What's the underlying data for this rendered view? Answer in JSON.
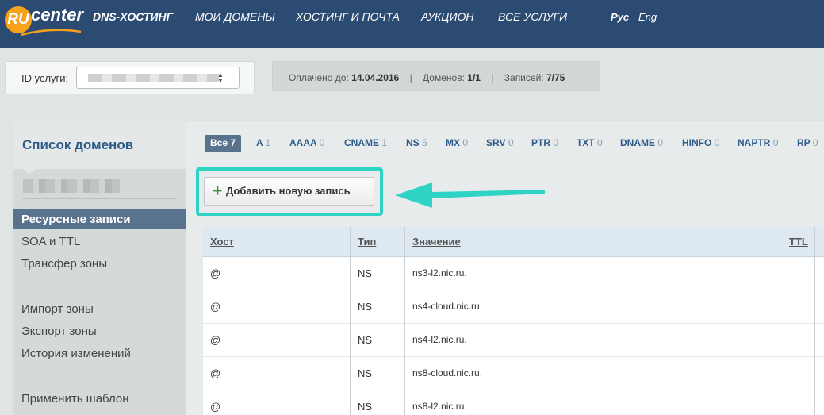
{
  "header": {
    "logo_ru": "RU",
    "logo_center": "center",
    "nav": [
      {
        "label": "DNS-ХОСТИНГ",
        "active": true
      },
      {
        "label": "МОИ ДОМЕНЫ",
        "active": false
      },
      {
        "label": "ХОСТИНГ И ПОЧТА",
        "active": false
      },
      {
        "label": "АУКЦИОН",
        "active": false
      },
      {
        "label": "ВСЕ УСЛУГИ",
        "active": false
      }
    ],
    "lang_ru": "Рус",
    "lang_en": "Eng"
  },
  "service": {
    "id_label": "ID услуги:",
    "paid_label": "Оплачено до:",
    "paid_value": "14.04.2016",
    "domains_label": "Доменов:",
    "domains_value": "1/1",
    "records_label": "Записей:",
    "records_value": "7/75"
  },
  "sidebar": {
    "title": "Список доменов",
    "items": [
      {
        "label": "Ресурсные записи",
        "active": true
      },
      {
        "label": "SOA и TTL",
        "active": false
      },
      {
        "label": "Трансфер зоны",
        "active": false
      },
      {
        "label": "Импорт зоны",
        "active": false
      },
      {
        "label": "Экспорт зоны",
        "active": false
      },
      {
        "label": "История изменений",
        "active": false
      },
      {
        "label": "Применить шаблон",
        "active": false
      }
    ]
  },
  "filters": [
    {
      "label": "Все",
      "count": "7",
      "active": true
    },
    {
      "label": "A",
      "count": "1"
    },
    {
      "label": "AAAA",
      "count": "0"
    },
    {
      "label": "CNAME",
      "count": "1"
    },
    {
      "label": "NS",
      "count": "5"
    },
    {
      "label": "MX",
      "count": "0"
    },
    {
      "label": "SRV",
      "count": "0"
    },
    {
      "label": "PTR",
      "count": "0"
    },
    {
      "label": "TXT",
      "count": "0"
    },
    {
      "label": "DNAME",
      "count": "0"
    },
    {
      "label": "HINFO",
      "count": "0"
    },
    {
      "label": "NAPTR",
      "count": "0"
    },
    {
      "label": "RP",
      "count": "0"
    }
  ],
  "add_button": {
    "icon": "plus-icon",
    "label": "Добавить новую запись"
  },
  "table": {
    "headers": {
      "host": "Хост",
      "type": "Тип",
      "value": "Значение",
      "ttl": "TTL"
    },
    "rows": [
      {
        "host": "@",
        "type": "NS",
        "value": "ns3-l2.nic.ru."
      },
      {
        "host": "@",
        "type": "NS",
        "value": "ns4-cloud.nic.ru."
      },
      {
        "host": "@",
        "type": "NS",
        "value": "ns4-l2.nic.ru."
      },
      {
        "host": "@",
        "type": "NS",
        "value": "ns8-cloud.nic.ru."
      },
      {
        "host": "@",
        "type": "NS",
        "value": "ns8-l2.nic.ru."
      }
    ]
  },
  "colors": {
    "topbar": "#2c4b73",
    "highlight": "#2ed3c4",
    "active_item": "#59728d",
    "link": "#2e5b8a"
  }
}
